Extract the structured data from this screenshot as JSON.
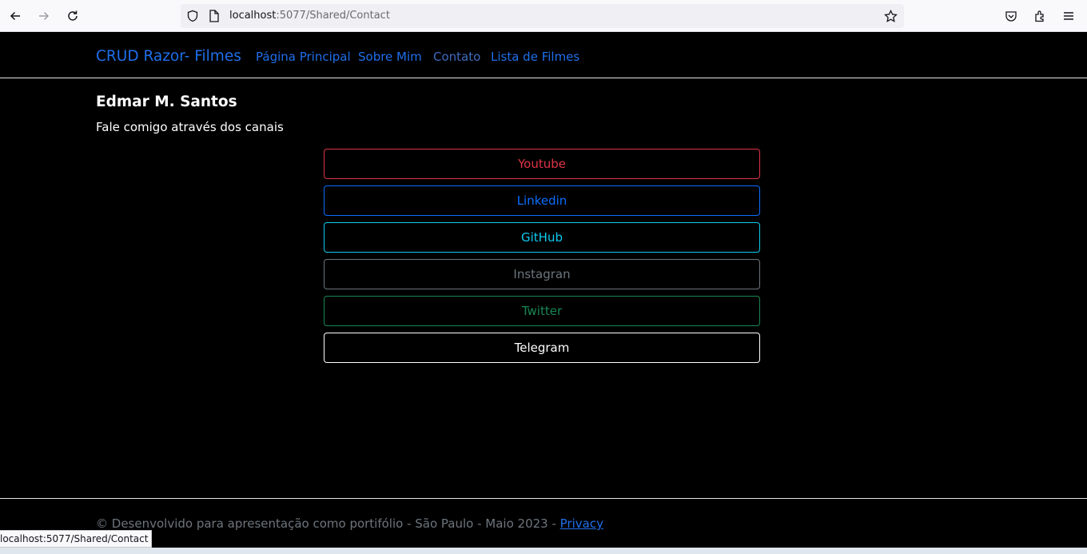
{
  "browser": {
    "url_host": "localhost",
    "url_path": ":5077/Shared/Contact",
    "status_url": "localhost:5077/Shared/Contact"
  },
  "site": {
    "brand": "CRUD Razor- Filmes",
    "nav": [
      {
        "label": "Página Principal"
      },
      {
        "label": "Sobre Mim"
      },
      {
        "label": "Contato"
      },
      {
        "label": "Lista de Filmes"
      }
    ]
  },
  "main": {
    "name": "Edmar M. Santos",
    "lead": "Fale comigo através dos canais",
    "channels": [
      {
        "label": "Youtube",
        "color": "#dc3545"
      },
      {
        "label": "Linkedin",
        "color": "#0d6efd"
      },
      {
        "label": "GitHub",
        "color": "#0dcaf0"
      },
      {
        "label": "Instagran",
        "color": "#6c757d"
      },
      {
        "label": "Twitter",
        "color": "#198754"
      },
      {
        "label": "Telegram",
        "color": "#ffffff"
      }
    ]
  },
  "footer": {
    "text": "© Desenvolvido para apresentação como portifólio - São Paulo - Maio 2023 - ",
    "link": "Privacy"
  },
  "icons": [
    "back-arrow-icon",
    "forward-arrow-icon",
    "reload-icon",
    "shield-icon",
    "page-icon",
    "star-icon",
    "pocket-icon",
    "extensions-icon",
    "menu-icon"
  ]
}
